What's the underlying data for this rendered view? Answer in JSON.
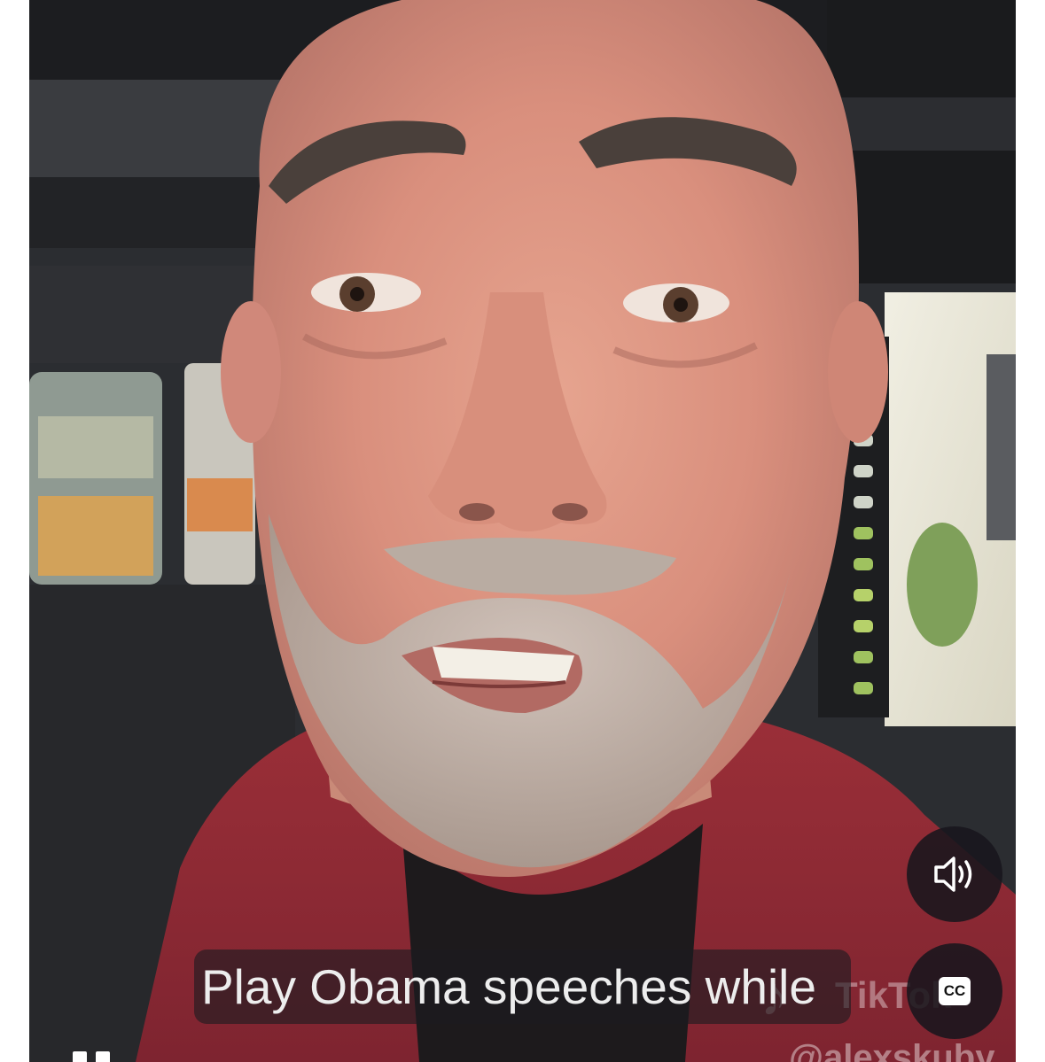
{
  "player": {
    "caption_text": "Play Obama speeches while",
    "watermark_brand": "TikTok",
    "watermark_handle": "@alexskuby",
    "controls": {
      "volume_icon": "speaker-icon",
      "captions_label": "CC",
      "pause_icon": "pause-icon"
    }
  },
  "colors": {
    "button_bg": "#18161c",
    "caption_bg": "#1c1c20",
    "caption_text": "#ededed",
    "shirt": "#8f2a33"
  }
}
